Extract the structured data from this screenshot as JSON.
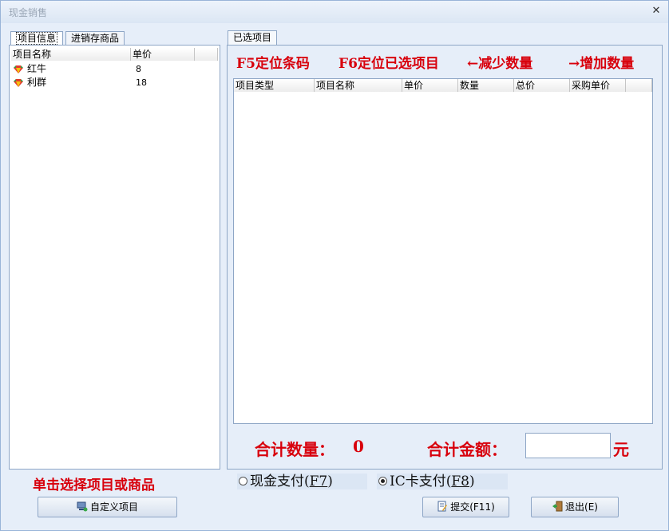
{
  "window": {
    "title": "现金销售",
    "close_glyph": "✕"
  },
  "left_tabs": [
    {
      "label": "项目信息",
      "active": true
    },
    {
      "label": "进销存商品",
      "active": false
    }
  ],
  "left_grid": {
    "columns": [
      "项目名称",
      "单价",
      ""
    ],
    "rows": [
      {
        "name": "红牛",
        "price": "8",
        "icon": "item-gem-icon"
      },
      {
        "name": "利群",
        "price": "18",
        "icon": "item-gem-icon"
      }
    ]
  },
  "right_tab": {
    "label": "已选项目"
  },
  "hints": {
    "f5": "F5定位条码",
    "f6": "F6定位已选项目",
    "decrease": "←减少数量",
    "increase": "→增加数量",
    "left_footer": "单击选择项目或商品"
  },
  "selected_grid": {
    "columns": [
      "项目类型",
      "项目名称",
      "单价",
      "数量",
      "总价",
      "采购单价",
      ""
    ]
  },
  "totals": {
    "qty_label": "合计数量：",
    "qty_value": "0",
    "amount_label": "合计金额：",
    "amount_value": "",
    "currency": "元"
  },
  "payment": {
    "cash": {
      "label": "现金支付(",
      "key": "F7",
      "close": ")",
      "selected": false
    },
    "ic": {
      "label": "IC卡支付(",
      "key": "F8",
      "close": ")",
      "selected": true
    }
  },
  "buttons": {
    "custom": "自定义项目",
    "submit": "提交(F11)",
    "exit": "退出(E)"
  },
  "colors": {
    "hint_red": "#d8000c",
    "border": "#8ea6c6"
  }
}
